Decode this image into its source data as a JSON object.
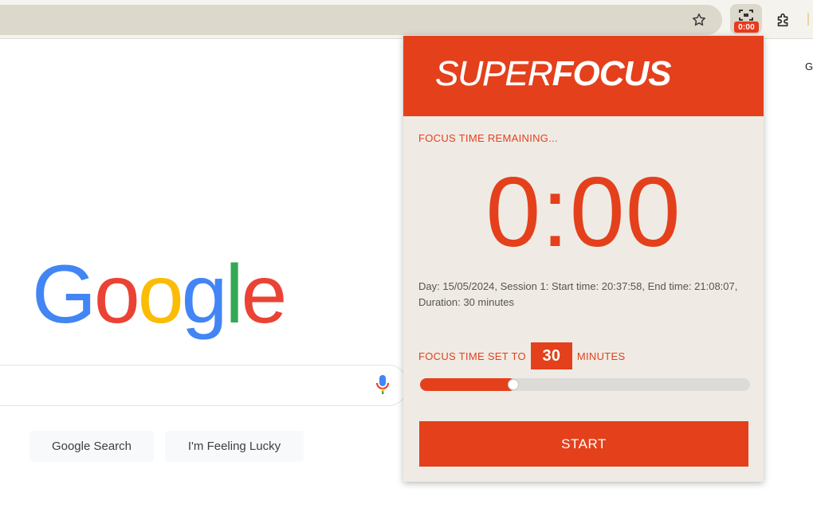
{
  "browser": {
    "bookmark_icon": "star-icon",
    "extension_icon": "focus-frame-icon",
    "extension_badge": "0:00",
    "extensions_menu_icon": "puzzle-icon"
  },
  "google": {
    "logo_letters": [
      {
        "char": "G",
        "color": "#4285f4"
      },
      {
        "char": "o",
        "color": "#ea4335"
      },
      {
        "char": "o",
        "color": "#fbbc05"
      },
      {
        "char": "g",
        "color": "#4285f4"
      },
      {
        "char": "l",
        "color": "#34a853"
      },
      {
        "char": "e",
        "color": "#ea4335"
      }
    ],
    "search_button": "Google Search",
    "lucky_button": "I'm Feeling Lucky",
    "right_edge_text": "G"
  },
  "superfocus": {
    "brand_light": "SUPER",
    "brand_bold": "FOCUS",
    "remaining_label": "FOCUS TIME REMAINING...",
    "timer": "0:00",
    "session_info": "Day: 15/05/2024, Session 1: Start time: 20:37:58, End time: 21:08:07, Duration: 30 minutes",
    "set_label_prefix": "FOCUS TIME SET TO",
    "minutes": "30",
    "set_label_suffix": "MINUTES",
    "slider_fraction": 0.27,
    "start_label": "START",
    "accent_color": "#e4401c",
    "background_color": "#efebe4"
  }
}
